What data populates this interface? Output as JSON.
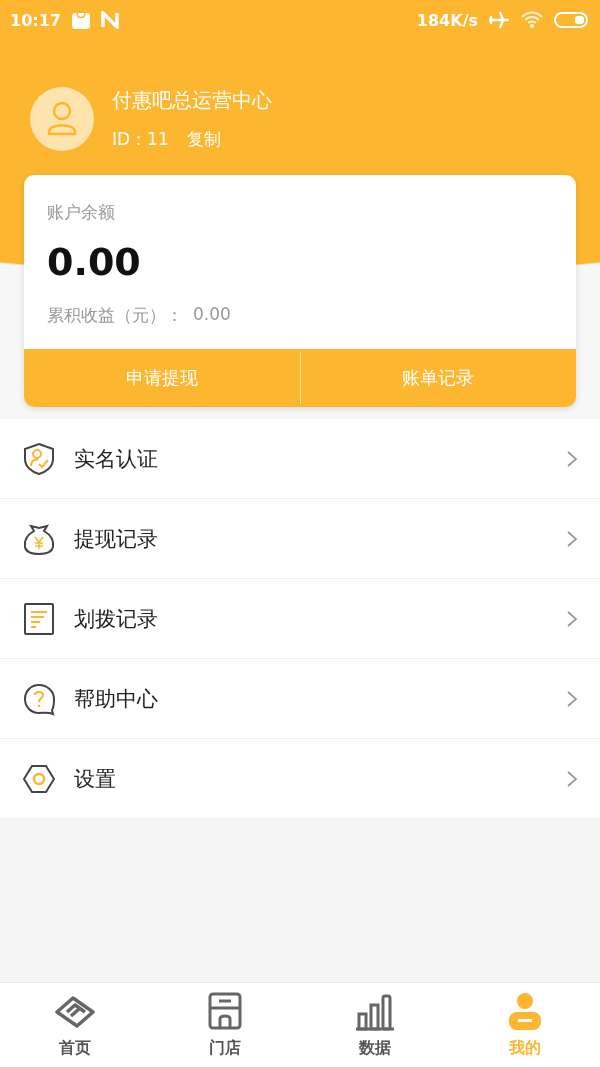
{
  "status_bar": {
    "time": "10:17",
    "speed": "184K/s"
  },
  "profile": {
    "name": "付惠吧总运营中心",
    "id_label": "ID：11",
    "copy": "复制"
  },
  "account": {
    "label": "账户余额",
    "balance": "0.00",
    "earnings_label": "累积收益（元）：",
    "earnings": "0.00",
    "actions": [
      "申请提现",
      "账单记录"
    ]
  },
  "menu": [
    {
      "kind": "shield",
      "label": "实名认证"
    },
    {
      "kind": "moneybag",
      "label": "提现记录"
    },
    {
      "kind": "document",
      "label": "划拨记录"
    },
    {
      "kind": "help",
      "label": "帮助中心"
    },
    {
      "kind": "settings",
      "label": "设置"
    }
  ],
  "tabs": [
    {
      "kind": "home",
      "label": "首页",
      "selected": false
    },
    {
      "kind": "store",
      "label": "门店",
      "selected": false
    },
    {
      "kind": "data",
      "label": "数据",
      "selected": false
    },
    {
      "kind": "mine",
      "label": "我的",
      "selected": true
    }
  ]
}
